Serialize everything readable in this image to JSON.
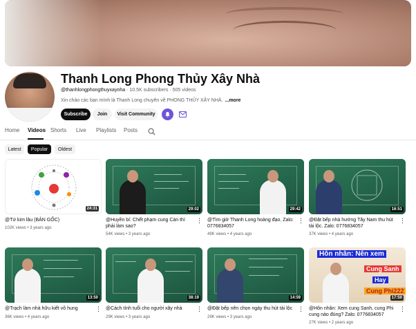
{
  "channel": {
    "name": "Thanh Long Phong Thủy Xây Nhà",
    "handle": "@thanhlongphongthuyxaynha",
    "subscribers": "10.5K subscribers",
    "videos": "505 videos",
    "description": "Xin chào các bạn mình là Thanh Long chuyên về PHONG THỦY XÂY NHÀ.",
    "more": "...more"
  },
  "buttons": {
    "subscribe": "Subscribe",
    "join": "Join",
    "visit": "Visit Community"
  },
  "tabs": [
    "Home",
    "Videos",
    "Shorts",
    "Live",
    "Playlists",
    "Posts"
  ],
  "chips": [
    "Latest",
    "Popular",
    "Oldest"
  ],
  "videos": [
    {
      "title": "@Tứ kim lâu (BẢN GỐC)",
      "views": "102K views",
      "age": "3 years ago",
      "duration": "24:31"
    },
    {
      "title": "@Huyền bí: Chết phạm cung Càn thì phải làm sao?",
      "views": "54K views",
      "age": "3 years ago",
      "duration": "29:02"
    },
    {
      "title": "@Tìm giờ Thanh Long hoàng đạo. Zalo: 0776834057",
      "views": "49K views",
      "age": "4 years ago",
      "duration": "29:42"
    },
    {
      "title": "@Đặt bếp nhà hướng Tây Nam thu hút tài lộc. Zalo: 0776834057",
      "views": "37K views",
      "age": "4 years ago",
      "duration": "16:51"
    },
    {
      "title": "@Trạch làm nhà hữu kiết vô hung",
      "views": "36K views",
      "age": "4 years ago",
      "duration": "13:50"
    },
    {
      "title": "@Cách tính tuổi cho người xây nhà",
      "views": "29K views",
      "age": "3 years ago",
      "duration": "38:19"
    },
    {
      "title": "@Đặt bếp nên chọn ngày thu hút tài lộc",
      "views": "29K views",
      "age": "3 years ago",
      "duration": "14:59"
    },
    {
      "title": "@Hôn nhân: Xem cung Sanh, cung Phi cung nào đúng? Zalo: 0776834057",
      "views": "27K views",
      "age": "2 years ago",
      "duration": "17:50"
    }
  ],
  "thumb8": {
    "line1": "Hôn nhân:  Nên xem",
    "line2": "Cung Sanh",
    "line3": "Hay",
    "line4": "Cung Phi222"
  },
  "colors": {
    "accent": "#6f53d8",
    "board": "#2f7a5a"
  },
  "icons": {
    "search": "search-icon",
    "bell": "bell-icon",
    "mail": "mail-icon"
  }
}
